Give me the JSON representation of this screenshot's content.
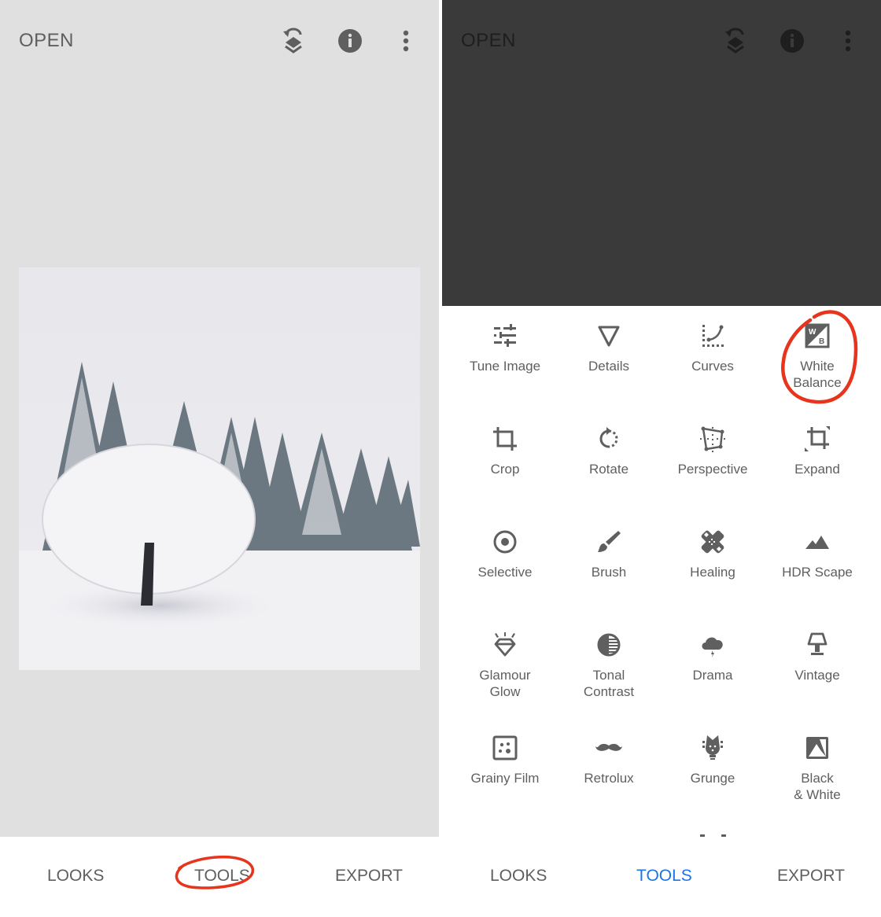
{
  "left_screen": {
    "header": {
      "open_label": "OPEN",
      "icons": [
        "layers-undo-icon",
        "info-icon",
        "more-vert-icon"
      ]
    },
    "image": {
      "description": "snow-covered trees in winter landscape"
    },
    "bottom_nav": {
      "tabs": [
        {
          "label": "LOOKS",
          "active": false
        },
        {
          "label": "TOOLS",
          "active": false,
          "annotated": true
        },
        {
          "label": "EXPORT",
          "active": false
        }
      ]
    }
  },
  "right_screen": {
    "header": {
      "open_label": "OPEN",
      "icons": [
        "layers-undo-icon",
        "info-icon",
        "more-vert-icon"
      ]
    },
    "tools": [
      {
        "label": "Tune Image",
        "icon": "tune-icon"
      },
      {
        "label": "Details",
        "icon": "details-triangle-icon"
      },
      {
        "label": "Curves",
        "icon": "curves-icon"
      },
      {
        "label": "White Balance",
        "label_lines": [
          "White",
          "Balance"
        ],
        "icon": "white-balance-icon",
        "annotated": true
      },
      {
        "label": "Crop",
        "icon": "crop-icon"
      },
      {
        "label": "Rotate",
        "icon": "rotate-icon"
      },
      {
        "label": "Perspective",
        "icon": "perspective-icon"
      },
      {
        "label": "Expand",
        "icon": "expand-icon"
      },
      {
        "label": "Selective",
        "icon": "selective-icon"
      },
      {
        "label": "Brush",
        "icon": "brush-icon"
      },
      {
        "label": "Healing",
        "icon": "healing-icon"
      },
      {
        "label": "HDR Scape",
        "icon": "mountains-icon"
      },
      {
        "label": "Glamour Glow",
        "label_lines": [
          "Glamour",
          "Glow"
        ],
        "icon": "diamond-icon"
      },
      {
        "label": "Tonal Contrast",
        "label_lines": [
          "Tonal",
          "Contrast"
        ],
        "icon": "tonal-contrast-icon"
      },
      {
        "label": "Drama",
        "icon": "storm-cloud-icon"
      },
      {
        "label": "Vintage",
        "icon": "lamp-icon"
      },
      {
        "label": "Grainy Film",
        "icon": "grainy-film-icon"
      },
      {
        "label": "Retrolux",
        "icon": "mustache-icon"
      },
      {
        "label": "Grunge",
        "icon": "guitar-head-icon"
      },
      {
        "label": "Black & White",
        "label_lines": [
          "Black",
          "& White"
        ],
        "icon": "black-white-icon"
      }
    ],
    "bottom_nav": {
      "tabs": [
        {
          "label": "LOOKS",
          "active": false
        },
        {
          "label": "TOOLS",
          "active": true
        },
        {
          "label": "EXPORT",
          "active": false
        }
      ]
    }
  },
  "colors": {
    "accent_active_tab": "#1a73e8",
    "annotation_red": "#e8341c",
    "icon_gray": "#5f5f5f",
    "left_bg": "#e0e0e0",
    "dark_overlay": "#3a3a3a"
  }
}
